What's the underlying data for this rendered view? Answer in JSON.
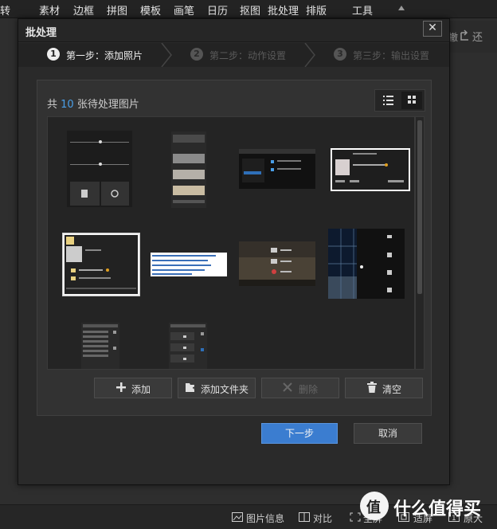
{
  "menubar": {
    "items": [
      "转",
      "素材",
      "边框",
      "拼图",
      "模板",
      "画笔",
      "日历",
      "抠图",
      "批处理",
      "排版",
      "工具"
    ]
  },
  "background_toolbar": {
    "left_text": "撤",
    "right_text": "还"
  },
  "dialog": {
    "title": "批处理",
    "close_glyph": "✕",
    "steps": [
      {
        "num": "1",
        "label": "第一步：添加照片"
      },
      {
        "num": "2",
        "label": "第二步：动作设置"
      },
      {
        "num": "3",
        "label": "第三步：输出设置"
      }
    ],
    "count_prefix": "共",
    "count_value": "10",
    "count_suffix": "张待处理图片",
    "buttons": {
      "add": "添加",
      "add_folder": "添加文件夹",
      "delete": "删除",
      "clear": "清空"
    },
    "next": "下一步",
    "cancel": "取消"
  },
  "bottombar": {
    "image_info": "图片信息",
    "compare": "对比",
    "fullscreen": "全屏",
    "fit": "适屏",
    "original": "原大"
  },
  "watermark": {
    "text": "什么值得买",
    "logo_glyph": "值"
  },
  "colors": {
    "accent": "#3b7dd0",
    "count_blue": "#4a9fe8"
  }
}
